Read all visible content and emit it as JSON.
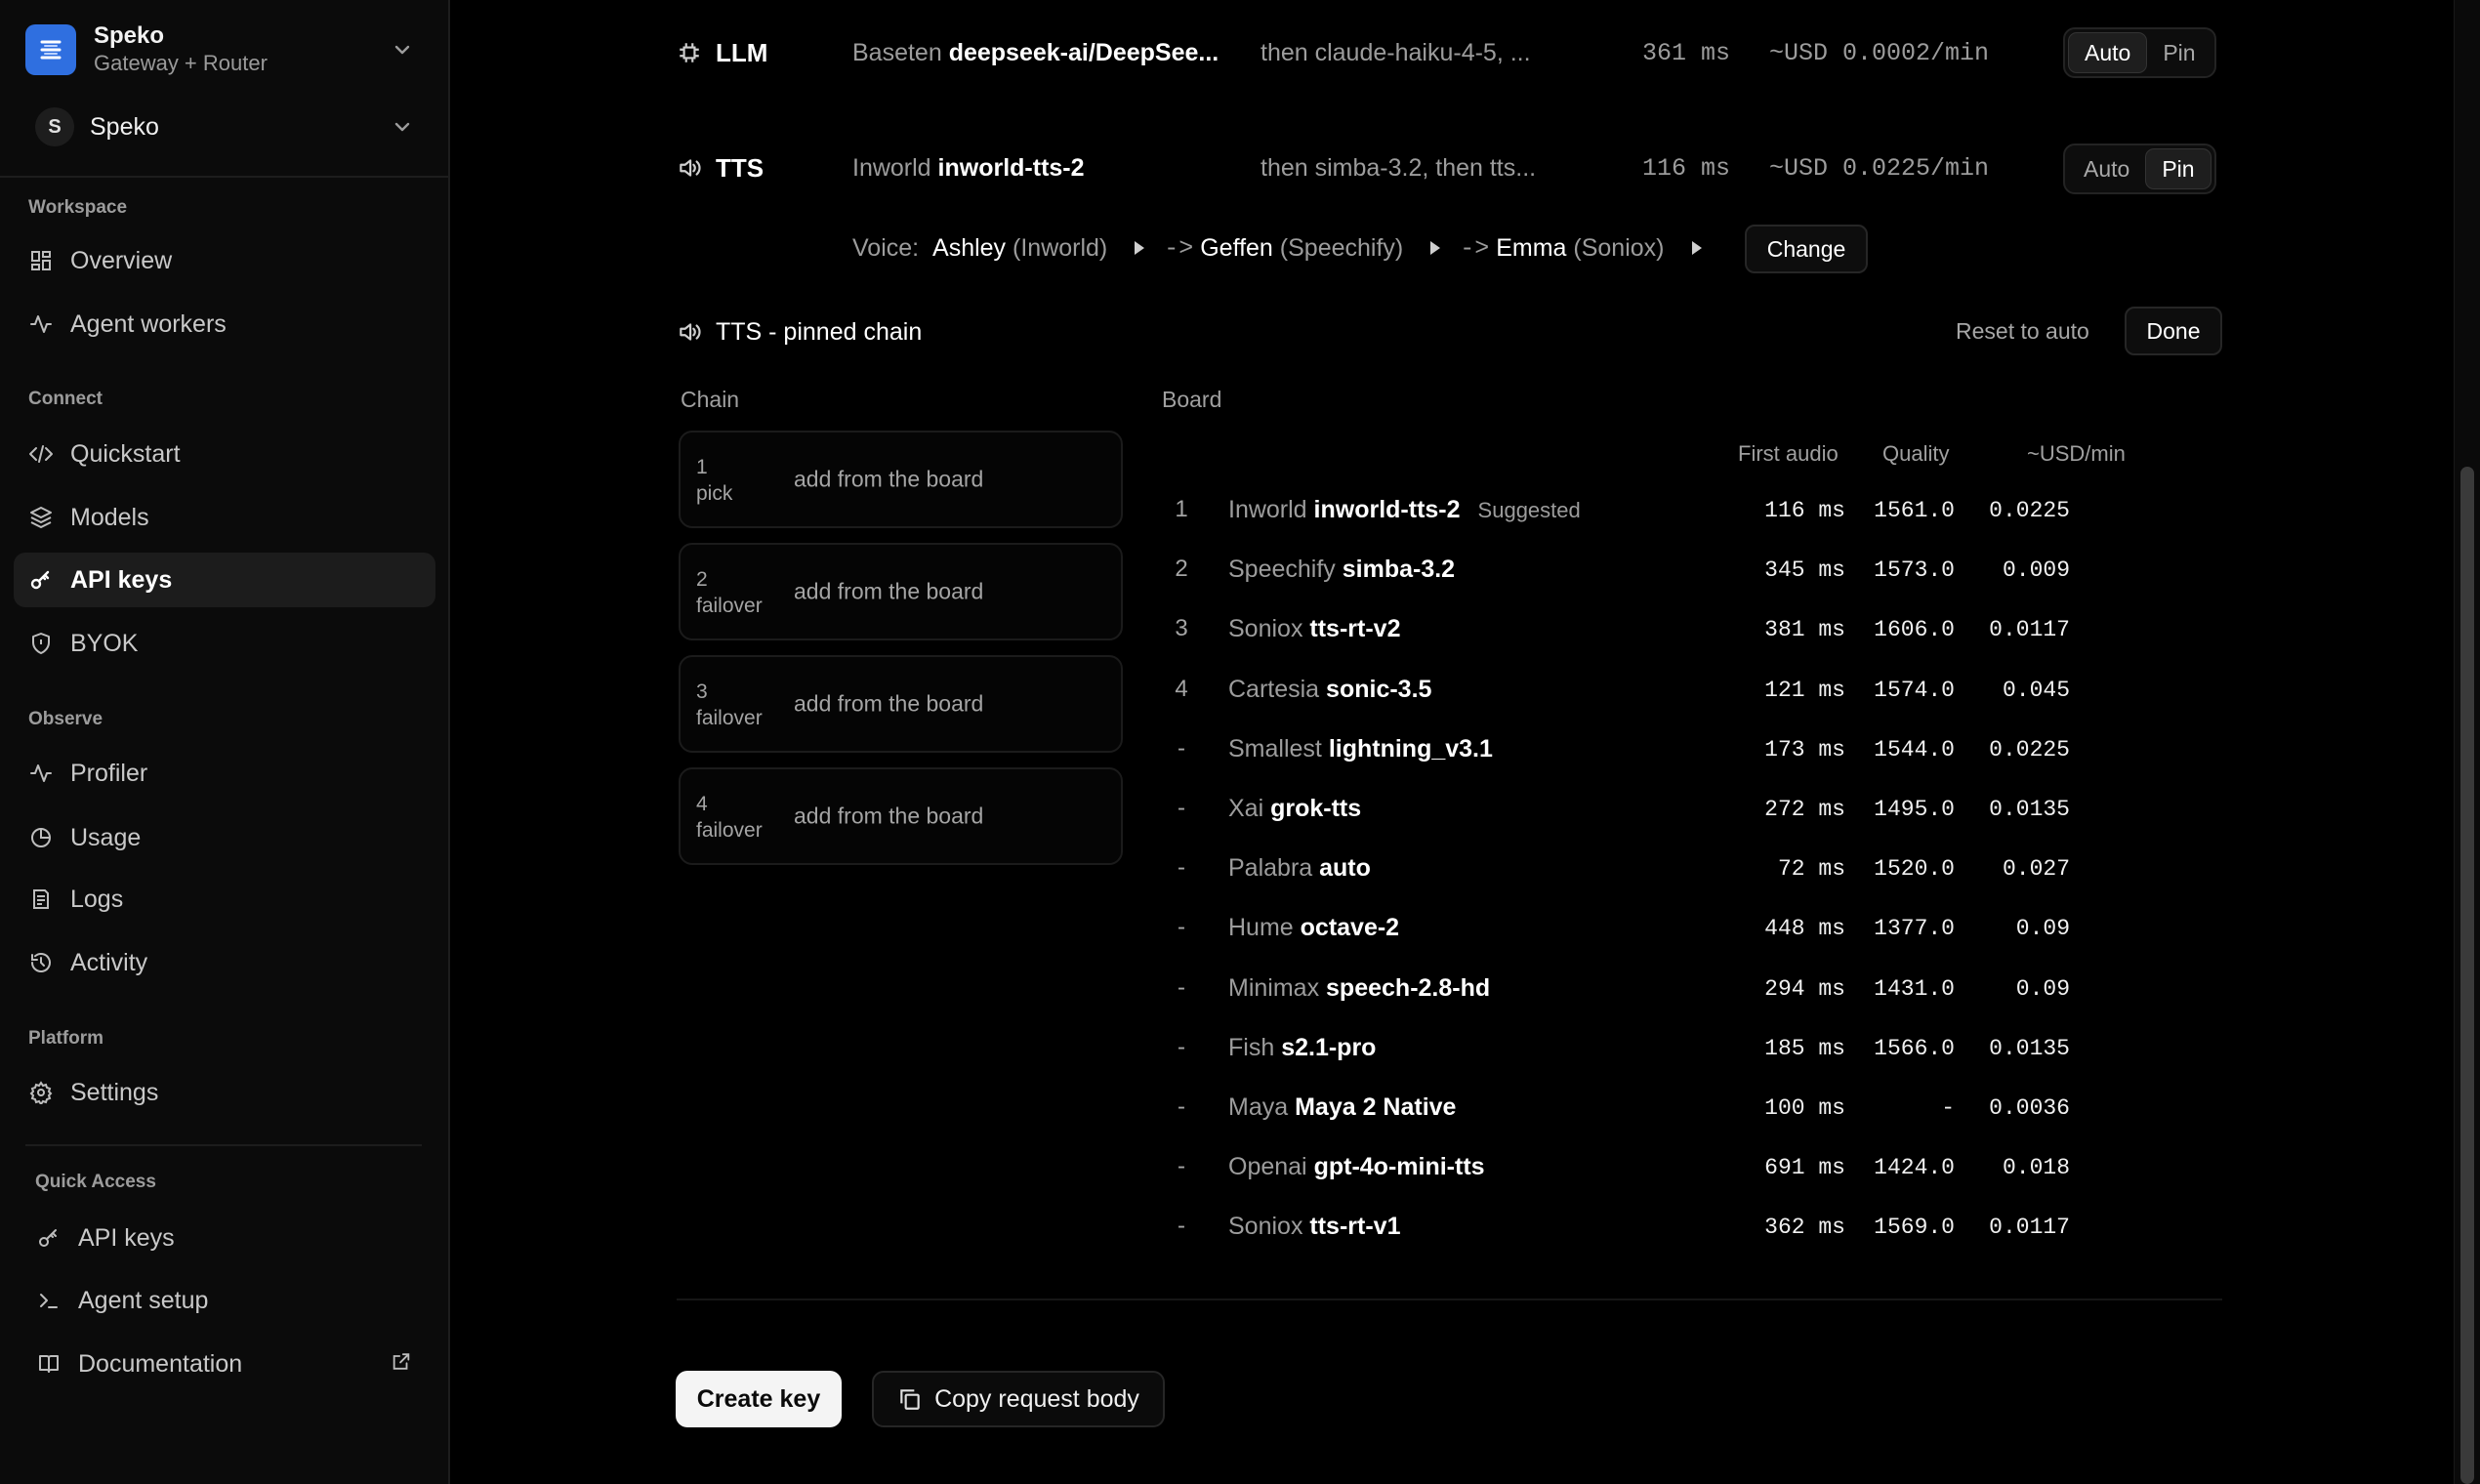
{
  "sidebar": {
    "org": {
      "name": "Speko",
      "subtitle": "Gateway + Router"
    },
    "project": {
      "initial": "S",
      "name": "Speko"
    },
    "sections": {
      "workspace": "Workspace",
      "connect": "Connect",
      "observe": "Observe",
      "platform": "Platform",
      "quick_access": "Quick Access"
    },
    "items": {
      "overview": "Overview",
      "agent_workers": "Agent workers",
      "quickstart": "Quickstart",
      "models": "Models",
      "api_keys": "API keys",
      "byok": "BYOK",
      "profiler": "Profiler",
      "usage": "Usage",
      "logs": "Logs",
      "activity": "Activity",
      "settings": "Settings",
      "qa_api_keys": "API keys",
      "qa_agent_setup": "Agent setup",
      "qa_documentation": "Documentation"
    }
  },
  "llm": {
    "title": "LLM",
    "provider": "Baseten",
    "model": "deepseek-ai/DeepSee...",
    "fallback": "then claude-haiku-4-5, ...",
    "latency": "361 ms",
    "cost": "~USD 0.0002/min",
    "mode_auto": "Auto",
    "mode_pin": "Pin",
    "selected": "Auto"
  },
  "tts": {
    "title": "TTS",
    "provider": "Inworld",
    "model": "inworld-tts-2",
    "fallback": "then simba-3.2, then tts...",
    "latency": "116 ms",
    "cost": "~USD 0.0225/min",
    "mode_auto": "Auto",
    "mode_pin": "Pin",
    "selected": "Pin",
    "voice_label": "Voice:",
    "voices": [
      {
        "name": "Ashley",
        "provider": "(Inworld)"
      },
      {
        "arrow": "->",
        "name": "Geffen",
        "provider": "(Speechify)"
      },
      {
        "arrow": "->",
        "name": "Emma",
        "provider": "(Soniox)"
      }
    ],
    "change_label": "Change"
  },
  "pinned": {
    "title": "TTS - pinned chain",
    "reset_label": "Reset to auto",
    "done_label": "Done",
    "chain_heading": "Chain",
    "board_heading": "Board",
    "chain": [
      {
        "n": "1",
        "role": "pick",
        "action": "add from the board"
      },
      {
        "n": "2",
        "role": "failover",
        "action": "add from the board"
      },
      {
        "n": "3",
        "role": "failover",
        "action": "add from the board"
      },
      {
        "n": "4",
        "role": "failover",
        "action": "add from the board"
      }
    ],
    "columns": {
      "first_audio": "First audio",
      "quality": "Quality",
      "cost": "~USD/min"
    },
    "board": [
      {
        "idx": "1",
        "provider": "Inworld",
        "model": "inworld-tts-2",
        "tag": "Suggested",
        "latency": "116 ms",
        "quality": "1561.0",
        "cost": "0.0225"
      },
      {
        "idx": "2",
        "provider": "Speechify",
        "model": "simba-3.2",
        "tag": "",
        "latency": "345 ms",
        "quality": "1573.0",
        "cost": "0.009"
      },
      {
        "idx": "3",
        "provider": "Soniox",
        "model": "tts-rt-v2",
        "tag": "",
        "latency": "381 ms",
        "quality": "1606.0",
        "cost": "0.0117"
      },
      {
        "idx": "4",
        "provider": "Cartesia",
        "model": "sonic-3.5",
        "tag": "",
        "latency": "121 ms",
        "quality": "1574.0",
        "cost": "0.045"
      },
      {
        "idx": "-",
        "provider": "Smallest",
        "model": "lightning_v3.1",
        "tag": "",
        "latency": "173 ms",
        "quality": "1544.0",
        "cost": "0.0225"
      },
      {
        "idx": "-",
        "provider": "Xai",
        "model": "grok-tts",
        "tag": "",
        "latency": "272 ms",
        "quality": "1495.0",
        "cost": "0.0135"
      },
      {
        "idx": "-",
        "provider": "Palabra",
        "model": "auto",
        "tag": "",
        "latency": "72 ms",
        "quality": "1520.0",
        "cost": "0.027"
      },
      {
        "idx": "-",
        "provider": "Hume",
        "model": "octave-2",
        "tag": "",
        "latency": "448 ms",
        "quality": "1377.0",
        "cost": "0.09"
      },
      {
        "idx": "-",
        "provider": "Minimax",
        "model": "speech-2.8-hd",
        "tag": "",
        "latency": "294 ms",
        "quality": "1431.0",
        "cost": "0.09"
      },
      {
        "idx": "-",
        "provider": "Fish",
        "model": "s2.1-pro",
        "tag": "",
        "latency": "185 ms",
        "quality": "1566.0",
        "cost": "0.0135"
      },
      {
        "idx": "-",
        "provider": "Maya",
        "model": "Maya 2 Native",
        "tag": "",
        "latency": "100 ms",
        "quality": "-",
        "cost": "0.0036"
      },
      {
        "idx": "-",
        "provider": "Openai",
        "model": "gpt-4o-mini-tts",
        "tag": "",
        "latency": "691 ms",
        "quality": "1424.0",
        "cost": "0.018"
      },
      {
        "idx": "-",
        "provider": "Soniox",
        "model": "tts-rt-v1",
        "tag": "",
        "latency": "362 ms",
        "quality": "1569.0",
        "cost": "0.0117"
      }
    ]
  },
  "footer": {
    "create_key": "Create key",
    "copy_body": "Copy request body"
  },
  "colors": {
    "accent": "#2f6fe0",
    "bg": "#000000",
    "sidebar_bg": "#0b0b0b"
  }
}
